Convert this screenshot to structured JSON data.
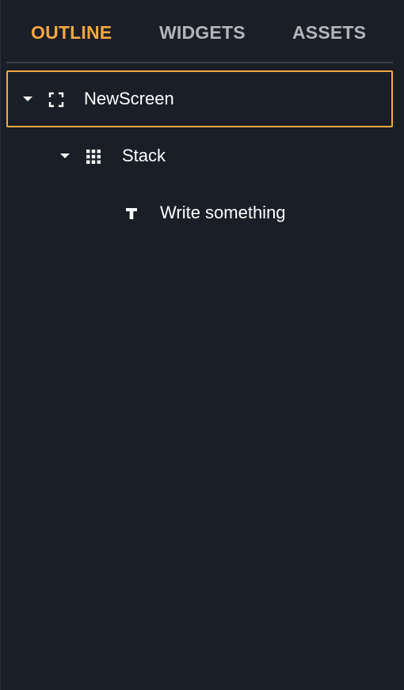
{
  "tabs": [
    {
      "label": "OUTLINE",
      "active": true
    },
    {
      "label": "WIDGETS",
      "active": false
    },
    {
      "label": "ASSETS",
      "active": false
    }
  ],
  "tree": [
    {
      "label": "NewScreen",
      "icon": "screen-frame-icon",
      "expanded": true,
      "selected": true,
      "depth": 0
    },
    {
      "label": "Stack",
      "icon": "grid-icon",
      "expanded": true,
      "selected": false,
      "depth": 1
    },
    {
      "label": "Write something",
      "icon": "text-icon",
      "selected": false,
      "depth": 2
    }
  ],
  "colors": {
    "background": "#1a1e26",
    "accent": "#f5a742",
    "inactive_tab": "#b3b5ba",
    "divider": "#3a3f48",
    "text": "#ffffff"
  }
}
